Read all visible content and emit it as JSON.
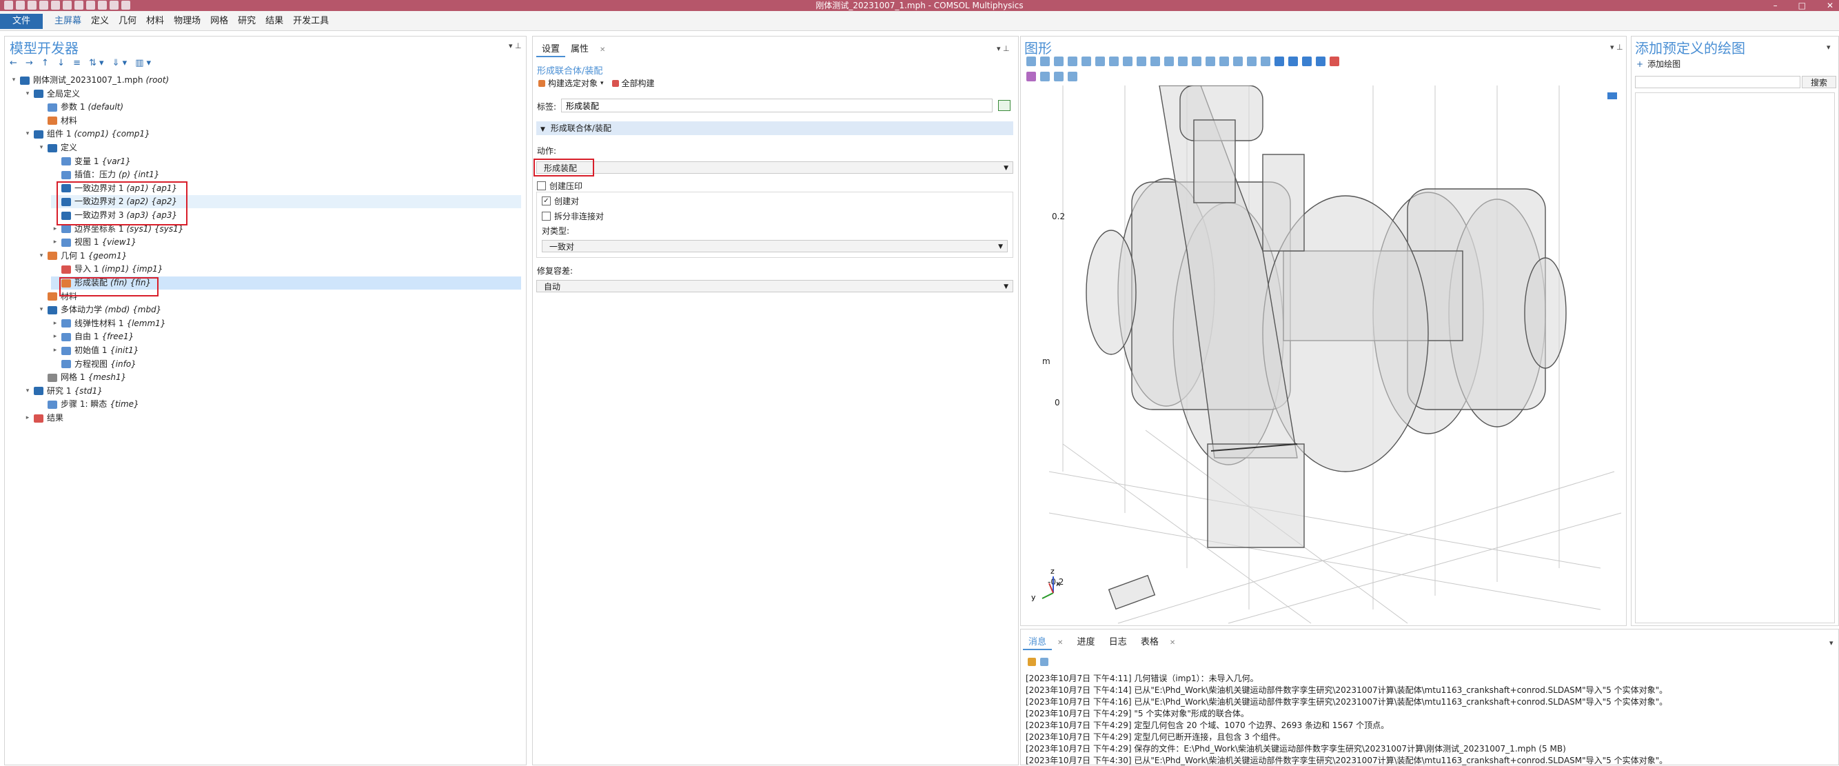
{
  "window": {
    "title": "刚体测试_20231007_1.mph - COMSOL Multiphysics",
    "controls": [
      "–",
      "□",
      "✕"
    ]
  },
  "menu": {
    "file": "文件",
    "items": [
      "主屏幕",
      "定义",
      "几何",
      "材料",
      "物理场",
      "网格",
      "研究",
      "结果",
      "开发工具"
    ]
  },
  "model_builder": {
    "title": "模型开发器",
    "tree": [
      {
        "label": "刚体测试_20231007_1.mph",
        "tag": "(root)"
      },
      {
        "label": "全局定义",
        "tag": ""
      },
      {
        "label": "参数 1",
        "tag": "(default)"
      },
      {
        "label": "材料",
        "tag": ""
      },
      {
        "label": "组件 1",
        "tag": "(comp1) {comp1}"
      },
      {
        "label": "定义",
        "tag": ""
      },
      {
        "label": "变量 1",
        "tag": "{var1}"
      },
      {
        "label": "插值：压力",
        "tag": "(p) {int1}"
      },
      {
        "label": "一致边界对 1",
        "tag": "(ap1) {ap1}"
      },
      {
        "label": "一致边界对 2",
        "tag": "(ap2) {ap2}"
      },
      {
        "label": "一致边界对 3",
        "tag": "(ap3) {ap3}"
      },
      {
        "label": "边界坐标系 1",
        "tag": "(sys1) {sys1}"
      },
      {
        "label": "视图 1",
        "tag": "{view1}"
      },
      {
        "label": "几何 1",
        "tag": "{geom1}"
      },
      {
        "label": "导入 1",
        "tag": "(imp1) {imp1}"
      },
      {
        "label": "形成装配",
        "tag": "(fin) {fin}"
      },
      {
        "label": "材料",
        "tag": ""
      },
      {
        "label": "多体动力学",
        "tag": "(mbd) {mbd}"
      },
      {
        "label": "线弹性材料 1",
        "tag": "{lemm1}"
      },
      {
        "label": "自由 1",
        "tag": "{free1}"
      },
      {
        "label": "初始值 1",
        "tag": "{init1}"
      },
      {
        "label": "方程视图",
        "tag": "{info}"
      },
      {
        "label": "网格 1",
        "tag": "{mesh1}"
      },
      {
        "label": "研究 1",
        "tag": "{std1}"
      },
      {
        "label": "步骤 1: 瞬态",
        "tag": "{time}"
      },
      {
        "label": "结果",
        "tag": ""
      }
    ]
  },
  "settings": {
    "tabs": [
      "设置",
      "属性"
    ],
    "heading": "形成联合体/装配",
    "build_selected": "构建选定对象",
    "build_all": "全部构建",
    "label_caption": "标签:",
    "label_value": "形成装配",
    "section": "形成联合体/装配",
    "action_caption": "动作:",
    "action_value": "形成装配",
    "create_imprint": "创建压印",
    "create_pairs": "创建对",
    "split_disjoint": "拆分非连接对",
    "pair_type_caption": "对类型:",
    "pair_type_value": "一致对",
    "repair_tol_caption": "修复容差:",
    "repair_tol_value": "自动",
    "create_imprint_checked": false,
    "create_pairs_checked": true,
    "split_disjoint_checked": false
  },
  "graphics": {
    "title": "图形",
    "axis_labels": {
      "top": "0.2",
      "mid": "0",
      "bottom": "-0.2",
      "unit": "m"
    },
    "triad": {
      "z": "z",
      "y": "y",
      "x": "x"
    }
  },
  "plot_panel": {
    "title": "添加预定义的绘图",
    "add_plot": "添加绘图",
    "search": "搜索"
  },
  "messages": {
    "tabs": [
      "消息",
      "进度",
      "日志",
      "表格"
    ],
    "lines": [
      "[2023年10月7日 下午4:11] 几何错误（imp1）：未导入几何。",
      "[2023年10月7日 下午4:14] 已从\"E:\\Phd_Work\\柴油机关键运动部件数字孪生研究\\20231007计算\\装配体\\mtu1163_crankshaft+conrod.SLDASM\"导入\"5 个实体对象\"。",
      "[2023年10月7日 下午4:16] 已从\"E:\\Phd_Work\\柴油机关键运动部件数字孪生研究\\20231007计算\\装配体\\mtu1163_crankshaft+conrod.SLDASM\"导入\"5 个实体对象\"。",
      "[2023年10月7日 下午4:29] \"5 个实体对象\"形成的联合体。",
      "[2023年10月7日 下午4:29] 定型几何包含 20 个域、1070 个边界、2693 条边和 1567 个顶点。",
      "[2023年10月7日 下午4:29] 定型几何已断开连接，且包含 3 个组件。",
      "[2023年10月7日 下午4:29] 保存的文件：E:\\Phd_Work\\柴油机关键运动部件数字孪生研究\\20231007计算\\刚体测试_20231007_1.mph (5 MB)",
      "[2023年10月7日 下午4:30] 已从\"E:\\Phd_Work\\柴油机关键运动部件数字孪生研究\\20231007计算\\装配体\\mtu1163_crankshaft+conrod.SLDASM\"导入\"5 个实体对象\"。"
    ]
  },
  "colors": {
    "titlebar": "#b6566a",
    "accent": "#4a8fd4",
    "file_tab": "#2b6cb0",
    "highlight_box": "#d81e2a",
    "selection": "#cfe5fb"
  }
}
